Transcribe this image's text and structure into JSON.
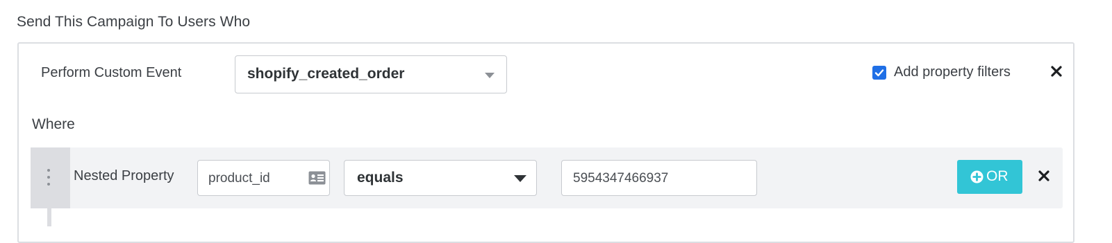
{
  "section": {
    "title": "Send This Campaign To Users Who"
  },
  "event": {
    "label": "Perform Custom Event",
    "selected": "shopify_created_order",
    "add_filters_label": "Add property filters",
    "add_filters_checked": true
  },
  "where": {
    "label": "Where",
    "filter": {
      "type_label": "Nested Property",
      "property": "product_id",
      "operator": "equals",
      "value": "5954347466937",
      "or_label": "OR"
    }
  },
  "colors": {
    "accent": "#1f6fe6",
    "or_button": "#32c5d6",
    "row_background": "#f2f3f5"
  },
  "icons": [
    "checkbox-checked-icon",
    "close-icon",
    "drag-handle-icon",
    "id-card-icon",
    "chevron-down-icon",
    "plus-circle-icon"
  ]
}
